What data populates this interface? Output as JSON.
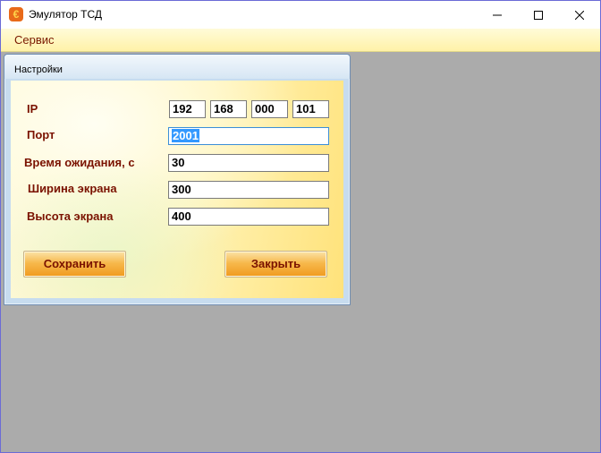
{
  "window": {
    "title": "Эмулятор ТСД",
    "app_icon_glyph": "€",
    "app_icon_name": "tsd-app-icon"
  },
  "menu": {
    "items": [
      {
        "label": "Сервис"
      }
    ]
  },
  "settings": {
    "title": "Настройки",
    "ip": {
      "label": "IP",
      "octets": [
        "192",
        "168",
        "000",
        "101"
      ]
    },
    "port": {
      "label": "Порт",
      "value": "2001"
    },
    "timeout": {
      "label": "Время ожидания, с",
      "value": "30"
    },
    "screen_width": {
      "label": "Ширина экрана",
      "value": "300"
    },
    "screen_height": {
      "label": "Высота экрана",
      "value": "400"
    },
    "save_label": "Сохранить",
    "close_label": "Закрыть"
  },
  "colors": {
    "label_text": "#7a1200",
    "menu_background": "#fff2a8",
    "mdi_background": "#ababab",
    "button_orange": "#f7b94d",
    "selection": "#3399ff"
  }
}
